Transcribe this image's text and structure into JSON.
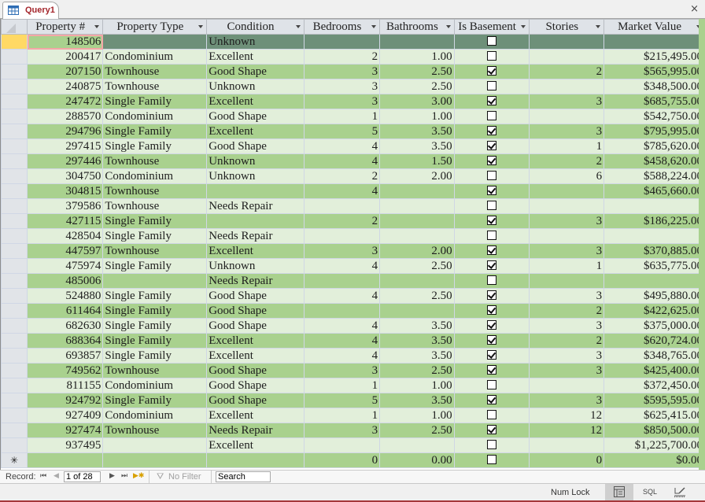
{
  "window": {
    "tab_title": "Query1",
    "close_symbol": "×"
  },
  "columns": [
    {
      "key": "property_num",
      "label": "Property #",
      "align": "num"
    },
    {
      "key": "property_type",
      "label": "Property Type",
      "align": "text"
    },
    {
      "key": "condition",
      "label": "Condition",
      "align": "text"
    },
    {
      "key": "bedrooms",
      "label": "Bedrooms",
      "align": "num"
    },
    {
      "key": "bathrooms",
      "label": "Bathrooms",
      "align": "num"
    },
    {
      "key": "is_basement",
      "label": "Is Basement",
      "align": "chk"
    },
    {
      "key": "stories",
      "label": "Stories",
      "align": "num"
    },
    {
      "key": "market_value",
      "label": "Market Value",
      "align": "num"
    }
  ],
  "rows": [
    {
      "property_num": "148506",
      "property_type": "",
      "condition": "Unknown",
      "bedrooms": "",
      "bathrooms": "",
      "is_basement": false,
      "stories": "",
      "market_value": ""
    },
    {
      "property_num": "200417",
      "property_type": "Condominium",
      "condition": "Excellent",
      "bedrooms": "2",
      "bathrooms": "1.00",
      "is_basement": false,
      "stories": "",
      "market_value": "$215,495.00"
    },
    {
      "property_num": "207150",
      "property_type": "Townhouse",
      "condition": "Good Shape",
      "bedrooms": "3",
      "bathrooms": "2.50",
      "is_basement": true,
      "stories": "2",
      "market_value": "$565,995.00"
    },
    {
      "property_num": "240875",
      "property_type": "Townhouse",
      "condition": "Unknown",
      "bedrooms": "3",
      "bathrooms": "2.50",
      "is_basement": false,
      "stories": "",
      "market_value": "$348,500.00"
    },
    {
      "property_num": "247472",
      "property_type": "Single Family",
      "condition": "Excellent",
      "bedrooms": "3",
      "bathrooms": "3.00",
      "is_basement": true,
      "stories": "3",
      "market_value": "$685,755.00"
    },
    {
      "property_num": "288570",
      "property_type": "Condominium",
      "condition": "Good Shape",
      "bedrooms": "1",
      "bathrooms": "1.00",
      "is_basement": false,
      "stories": "",
      "market_value": "$542,750.00"
    },
    {
      "property_num": "294796",
      "property_type": "Single Family",
      "condition": "Excellent",
      "bedrooms": "5",
      "bathrooms": "3.50",
      "is_basement": true,
      "stories": "3",
      "market_value": "$795,995.00"
    },
    {
      "property_num": "297415",
      "property_type": "Single Family",
      "condition": "Good Shape",
      "bedrooms": "4",
      "bathrooms": "3.50",
      "is_basement": true,
      "stories": "1",
      "market_value": "$785,620.00"
    },
    {
      "property_num": "297446",
      "property_type": "Townhouse",
      "condition": "Unknown",
      "bedrooms": "4",
      "bathrooms": "1.50",
      "is_basement": true,
      "stories": "2",
      "market_value": "$458,620.00"
    },
    {
      "property_num": "304750",
      "property_type": "Condominium",
      "condition": "Unknown",
      "bedrooms": "2",
      "bathrooms": "2.00",
      "is_basement": false,
      "stories": "6",
      "market_value": "$588,224.00"
    },
    {
      "property_num": "304815",
      "property_type": "Townhouse",
      "condition": "",
      "bedrooms": "4",
      "bathrooms": "",
      "is_basement": true,
      "stories": "",
      "market_value": "$465,660.00"
    },
    {
      "property_num": "379586",
      "property_type": "Townhouse",
      "condition": "Needs Repair",
      "bedrooms": "",
      "bathrooms": "",
      "is_basement": false,
      "stories": "",
      "market_value": ""
    },
    {
      "property_num": "427115",
      "property_type": "Single Family",
      "condition": "",
      "bedrooms": "2",
      "bathrooms": "",
      "is_basement": true,
      "stories": "3",
      "market_value": "$186,225.00"
    },
    {
      "property_num": "428504",
      "property_type": "Single Family",
      "condition": "Needs Repair",
      "bedrooms": "",
      "bathrooms": "",
      "is_basement": false,
      "stories": "",
      "market_value": ""
    },
    {
      "property_num": "447597",
      "property_type": "Townhouse",
      "condition": "Excellent",
      "bedrooms": "3",
      "bathrooms": "2.00",
      "is_basement": true,
      "stories": "3",
      "market_value": "$370,885.00"
    },
    {
      "property_num": "475974",
      "property_type": "Single Family",
      "condition": "Unknown",
      "bedrooms": "4",
      "bathrooms": "2.50",
      "is_basement": true,
      "stories": "1",
      "market_value": "$635,775.00"
    },
    {
      "property_num": "485006",
      "property_type": "",
      "condition": "Needs Repair",
      "bedrooms": "",
      "bathrooms": "",
      "is_basement": false,
      "stories": "",
      "market_value": ""
    },
    {
      "property_num": "524880",
      "property_type": "Single Family",
      "condition": "Good Shape",
      "bedrooms": "4",
      "bathrooms": "2.50",
      "is_basement": true,
      "stories": "3",
      "market_value": "$495,880.00"
    },
    {
      "property_num": "611464",
      "property_type": "Single Family",
      "condition": "Good Shape",
      "bedrooms": "",
      "bathrooms": "",
      "is_basement": true,
      "stories": "2",
      "market_value": "$422,625.00"
    },
    {
      "property_num": "682630",
      "property_type": "Single Family",
      "condition": "Good Shape",
      "bedrooms": "4",
      "bathrooms": "3.50",
      "is_basement": true,
      "stories": "3",
      "market_value": "$375,000.00"
    },
    {
      "property_num": "688364",
      "property_type": "Single Family",
      "condition": "Excellent",
      "bedrooms": "4",
      "bathrooms": "3.50",
      "is_basement": true,
      "stories": "2",
      "market_value": "$620,724.00"
    },
    {
      "property_num": "693857",
      "property_type": "Single Family",
      "condition": "Excellent",
      "bedrooms": "4",
      "bathrooms": "3.50",
      "is_basement": true,
      "stories": "3",
      "market_value": "$348,765.00"
    },
    {
      "property_num": "749562",
      "property_type": "Townhouse",
      "condition": "Good Shape",
      "bedrooms": "3",
      "bathrooms": "2.50",
      "is_basement": true,
      "stories": "3",
      "market_value": "$425,400.00"
    },
    {
      "property_num": "811155",
      "property_type": "Condominium",
      "condition": "Good Shape",
      "bedrooms": "1",
      "bathrooms": "1.00",
      "is_basement": false,
      "stories": "",
      "market_value": "$372,450.00"
    },
    {
      "property_num": "924792",
      "property_type": "Single Family",
      "condition": "Good Shape",
      "bedrooms": "5",
      "bathrooms": "3.50",
      "is_basement": true,
      "stories": "3",
      "market_value": "$595,595.00"
    },
    {
      "property_num": "927409",
      "property_type": "Condominium",
      "condition": "Excellent",
      "bedrooms": "1",
      "bathrooms": "1.00",
      "is_basement": false,
      "stories": "12",
      "market_value": "$625,415.00"
    },
    {
      "property_num": "927474",
      "property_type": "Townhouse",
      "condition": "Needs Repair",
      "bedrooms": "3",
      "bathrooms": "2.50",
      "is_basement": true,
      "stories": "12",
      "market_value": "$850,500.00"
    },
    {
      "property_num": "937495",
      "property_type": "",
      "condition": "Excellent",
      "bedrooms": "",
      "bathrooms": "",
      "is_basement": false,
      "stories": "",
      "market_value": "$1,225,700.00"
    }
  ],
  "new_row": {
    "marker": "✳",
    "property_num": "",
    "property_type": "",
    "condition": "",
    "bedrooms": "0",
    "bathrooms": "0.00",
    "is_basement": false,
    "stories": "0",
    "market_value": "$0.00"
  },
  "record_nav": {
    "label": "Record:",
    "current": "1 of 28",
    "filter_label": "No Filter",
    "search_placeholder": "Search"
  },
  "status_bar": {
    "num_lock": "Num Lock",
    "sql_label": "SQL"
  },
  "colors": {
    "row_light": "#e2efda",
    "row_dark": "#a9d18e",
    "row_selected": "#6e9079",
    "accent": "#a4262c"
  }
}
